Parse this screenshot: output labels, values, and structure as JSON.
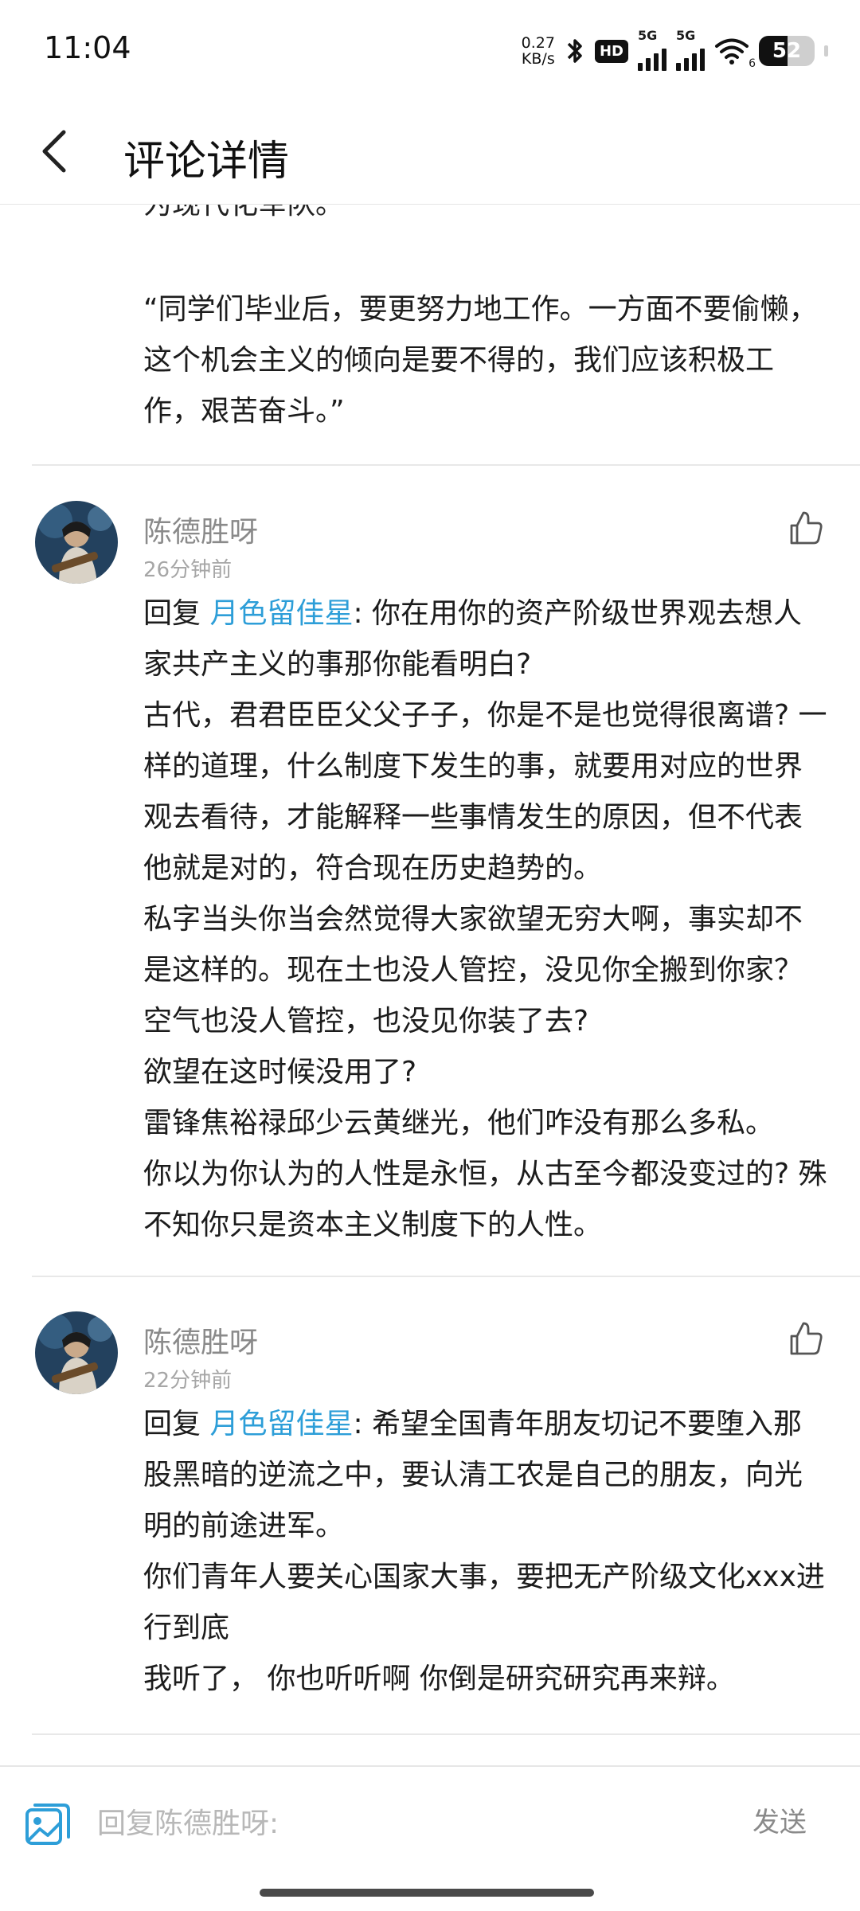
{
  "status_bar": {
    "time": "11:04",
    "net_speed_value": "0.27",
    "net_speed_unit": "KB/s",
    "hd_label": "HD",
    "sim1_label": "5G",
    "sim2_label": "5G",
    "wifi_label": "6",
    "battery": "52",
    "battery_level": 0.52
  },
  "header": {
    "title": "评论详情"
  },
  "content": {
    "cut_line": "为现代化军队。",
    "prev_quote": "“同学们毕业后，要更努力地工作。一方面不要偷懒，这个机会主义的倾向是要不得的，我们应该积极工作，艰苦奋斗。”"
  },
  "comments": [
    {
      "author": "陈德胜呀",
      "time": "26分钟前",
      "reply_prefix": "回复 ",
      "mention": "月色留佳星",
      "first_text": ": 你在用你的资产阶级世界观去想人家共产主义的事那你能看明白?",
      "lines": [
        "古代，君君臣臣父父子子，你是不是也觉得很离谱? 一样的道理，什么制度下发生的事，就要用对应的世界观去看待，才能解释一些事情发生的原因，但不代表他就是对的，符合现在历史趋势的。",
        "私字当头你当会然觉得大家欲望无穷大啊，事实却不是这样的。现在土也没人管控，没见你全搬到你家？空气也没人管控，也没见你装了去?",
        "欲望在这时候没用了?",
        "雷锋焦裕禄邱少云黄继光，他们咋没有那么多私。",
        "你以为你认为的人性是永恒，从古至今都没变过的? 殊不知你只是资本主义制度下的人性。"
      ]
    },
    {
      "author": "陈德胜呀",
      "time": "22分钟前",
      "reply_prefix": "回复 ",
      "mention": "月色留佳星",
      "first_text": ": 希望全国青年朋友切记不要堕入那股黑暗的逆流之中，要认清工农是自己的朋友，向光明的前途进军。",
      "lines": [
        "你们青年人要关心国家大事，要把无产阶级文化xxx进行到底",
        "我听了，  你也听听啊 你倒是研究研究再来辩。"
      ]
    }
  ],
  "bottom_bar": {
    "placeholder": "回复陈德胜呀:",
    "send_label": "发送"
  },
  "icons": {
    "back": "chevron-left-icon",
    "like": "thumbs-up-icon",
    "image": "image-icon",
    "bluetooth": "bluetooth-icon",
    "wifi": "wifi-icon"
  },
  "colors": {
    "mention": "#2d9ed8",
    "image_icon": "#2d9ed8",
    "meta_text": "#8a8a8a"
  }
}
